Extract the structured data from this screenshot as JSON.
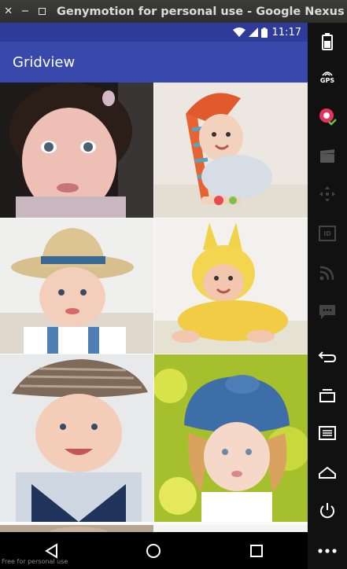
{
  "window": {
    "title": "Genymotion for personal use - Google Nexus 6"
  },
  "statusbar": {
    "time": "11:17"
  },
  "app": {
    "title": "Gridview"
  },
  "grid": {
    "photos": [
      {
        "subject": "baby with dark hair, pink lips"
      },
      {
        "subject": "baby in striped knit hat crawling"
      },
      {
        "subject": "baby in straw hat with blue band"
      },
      {
        "subject": "baby in yellow bunny costume"
      },
      {
        "subject": "boy in tweed flat cap and vest"
      },
      {
        "subject": "girl in blue denim sun hat"
      },
      {
        "subject": "partially visible photo"
      },
      {
        "subject": "partially visible photo"
      }
    ]
  },
  "toolbar": {
    "gps_label": "GPS",
    "id_label": "ID"
  },
  "watermark": "Free for personal use"
}
